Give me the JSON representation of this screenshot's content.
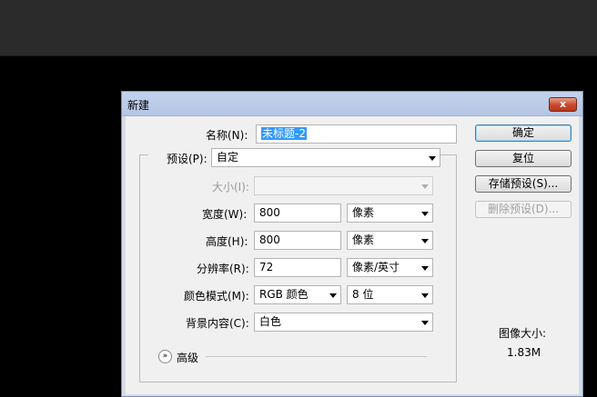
{
  "dialog": {
    "title": "新建",
    "close_label": "x"
  },
  "form": {
    "name_label": "名称(N):",
    "name_value": "未标题-2",
    "preset_label": "预设(P):",
    "preset_value": "自定",
    "size_label": "大小(I):",
    "size_value": "",
    "width_label": "宽度(W):",
    "width_value": "800",
    "width_unit": "像素",
    "height_label": "高度(H):",
    "height_value": "800",
    "height_unit": "像素",
    "resolution_label": "分辨率(R):",
    "resolution_value": "72",
    "resolution_unit": "像素/英寸",
    "color_mode_label": "颜色模式(M):",
    "color_mode_value": "RGB 颜色",
    "bit_depth_value": "8 位",
    "background_label": "背景内容(C):",
    "background_value": "白色",
    "advanced_label": "高级",
    "advanced_icon": "chevron-double-down-icon"
  },
  "buttons": {
    "ok": "确定",
    "reset": "复位",
    "save_preset": "存储预设(S)...",
    "delete_preset": "删除预设(D)..."
  },
  "image_size": {
    "label": "图像大小:",
    "value": "1.83M"
  },
  "colors": {
    "selection": "#3399ff",
    "close_button": "#c9472c",
    "title_bar": "#b5c6e4"
  }
}
